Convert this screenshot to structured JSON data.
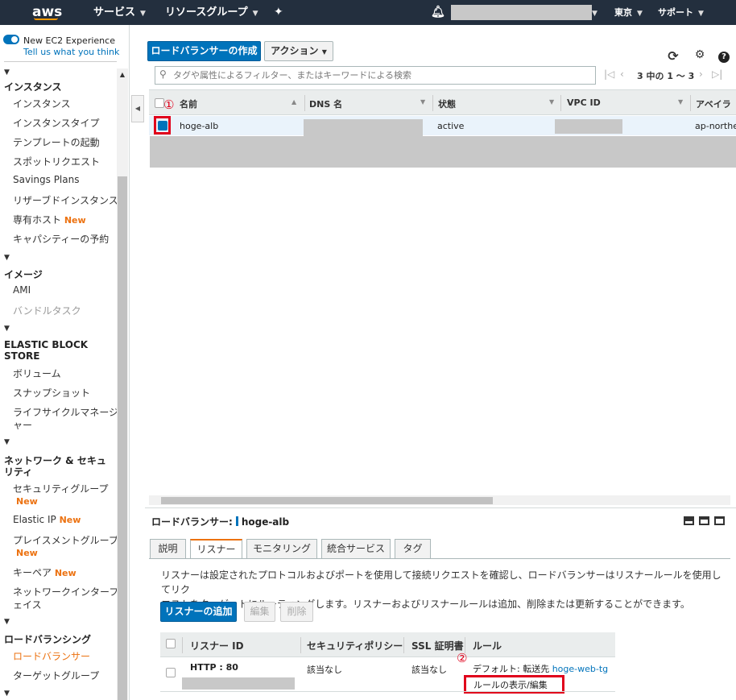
{
  "topbar": {
    "logo": "aws",
    "services": "サービス",
    "resource_groups": "リソースグループ",
    "region": "東京",
    "support": "サポート"
  },
  "sidebar": {
    "new_experience": "New EC2 Experience",
    "tell_us": "Tell us what you think",
    "new_badge": "New",
    "sections": {
      "instances": "インスタンス",
      "images": "イメージ",
      "ebs_line1": "ELASTIC BLOCK",
      "ebs_line2": "STORE",
      "network_line1": "ネットワーク & セキュ",
      "network_line2": "リティ",
      "load_balancing": "ロードバランシング"
    },
    "items": {
      "instances": "インスタンス",
      "instance_types": "インスタンスタイプ",
      "launch_templates": "テンプレートの起動",
      "spot_requests": "スポットリクエスト",
      "savings_plans": "Savings Plans",
      "reserved_instances": "リザーブドインスタンス",
      "dedicated_hosts": "専有ホスト",
      "capacity_reservations": "キャパシティーの予約",
      "ami": "AMI",
      "bundle_tasks": "バンドルタスク",
      "volumes": "ボリューム",
      "snapshots": "スナップショット",
      "lifecycle_line1": "ライフサイクルマネージ",
      "lifecycle_line2": "ャー",
      "security_groups": "セキュリティグループ",
      "elastic_ip": "Elastic IP",
      "placement_line1": "プレイスメントグループ",
      "key_pairs": "キーペア",
      "eni_line1": "ネットワークインターフ",
      "eni_line2": "ェイス",
      "load_balancers": "ロードバランサー",
      "target_groups": "ターゲットグループ"
    }
  },
  "toolbar": {
    "create_lb": "ロードバランサーの作成",
    "actions": "アクション",
    "search_placeholder": "タグや属性によるフィルター、またはキーワードによる検索",
    "pagination": "3 中の 1 ～ 3"
  },
  "grid": {
    "columns": [
      "名前",
      "DNS 名",
      "状態",
      "VPC ID",
      "アベイラ"
    ],
    "row": {
      "name": "hoge-alb",
      "state": "active",
      "az": "ap-northe"
    }
  },
  "annotations": {
    "one": "①",
    "two": "②"
  },
  "detail": {
    "label": "ロードバランサー:",
    "name": "hoge-alb",
    "tabs": [
      "説明",
      "リスナー",
      "モニタリング",
      "統合サービス",
      "タグ"
    ],
    "description_line1": "リスナーは設定されたプロトコルおよびポートを使用して接続リクエストを確認し、ロードバランサーはリスナールールを使用してリク",
    "description_line2": "エストをターゲットにルーティングします。リスナーおよびリスナールールは追加、削除または更新することができます。",
    "add_listener": "リスナーの追加",
    "edit": "編集",
    "delete": "削除",
    "listener_columns": [
      "リスナー ID",
      "セキュリティポリシー",
      "SSL 証明書",
      "ルール"
    ],
    "listener_row": {
      "id": "HTTP : 80",
      "policy": "該当なし",
      "cert": "該当なし",
      "default_label": "デフォルト: 転送先",
      "target": "hoge-web-tg",
      "rules_link": "ルールの表示/編集"
    }
  }
}
